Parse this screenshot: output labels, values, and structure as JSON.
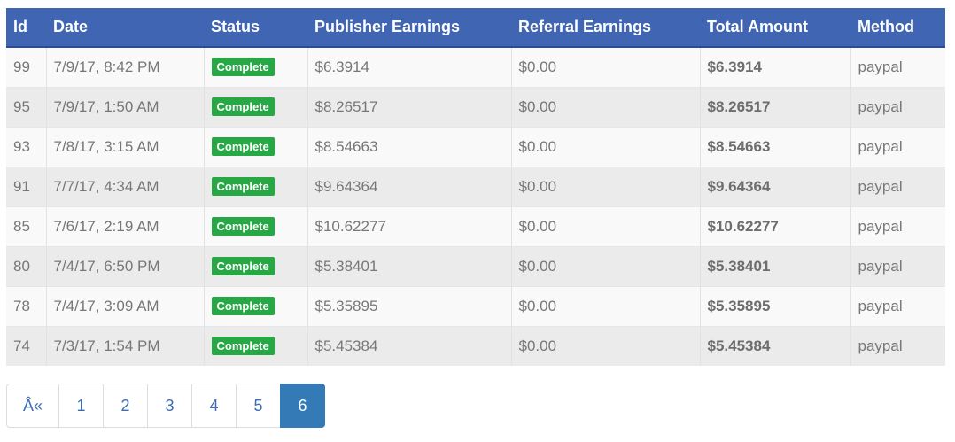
{
  "table": {
    "headers": [
      "Id",
      "Date",
      "Status",
      "Publisher Earnings",
      "Referral Earnings",
      "Total Amount",
      "Method"
    ],
    "rows": [
      {
        "id": "99",
        "date": "7/9/17, 8:42 PM",
        "status": "Complete",
        "publisher": "$6.3914",
        "referral": "$0.00",
        "total": "$6.3914",
        "method": "paypal"
      },
      {
        "id": "95",
        "date": "7/9/17, 1:50 AM",
        "status": "Complete",
        "publisher": "$8.26517",
        "referral": "$0.00",
        "total": "$8.26517",
        "method": "paypal"
      },
      {
        "id": "93",
        "date": "7/8/17, 3:15 AM",
        "status": "Complete",
        "publisher": "$8.54663",
        "referral": "$0.00",
        "total": "$8.54663",
        "method": "paypal"
      },
      {
        "id": "91",
        "date": "7/7/17, 4:34 AM",
        "status": "Complete",
        "publisher": "$9.64364",
        "referral": "$0.00",
        "total": "$9.64364",
        "method": "paypal"
      },
      {
        "id": "85",
        "date": "7/6/17, 2:19 AM",
        "status": "Complete",
        "publisher": "$10.62277",
        "referral": "$0.00",
        "total": "$10.62277",
        "method": "paypal"
      },
      {
        "id": "80",
        "date": "7/4/17, 6:50 PM",
        "status": "Complete",
        "publisher": "$5.38401",
        "referral": "$0.00",
        "total": "$5.38401",
        "method": "paypal"
      },
      {
        "id": "78",
        "date": "7/4/17, 3:09 AM",
        "status": "Complete",
        "publisher": "$5.35895",
        "referral": "$0.00",
        "total": "$5.35895",
        "method": "paypal"
      },
      {
        "id": "74",
        "date": "7/3/17, 1:54 PM",
        "status": "Complete",
        "publisher": "$5.45384",
        "referral": "$0.00",
        "total": "$5.45384",
        "method": "paypal"
      }
    ]
  },
  "colors": {
    "header_bg": "#3f65b3",
    "badge_complete": "#28a745",
    "page_active": "#337ab7",
    "page_link": "#3c6cb4"
  },
  "pagination": {
    "prev_label": "Â«",
    "pages": [
      "1",
      "2",
      "3",
      "4",
      "5",
      "6"
    ],
    "active_page": "6"
  }
}
